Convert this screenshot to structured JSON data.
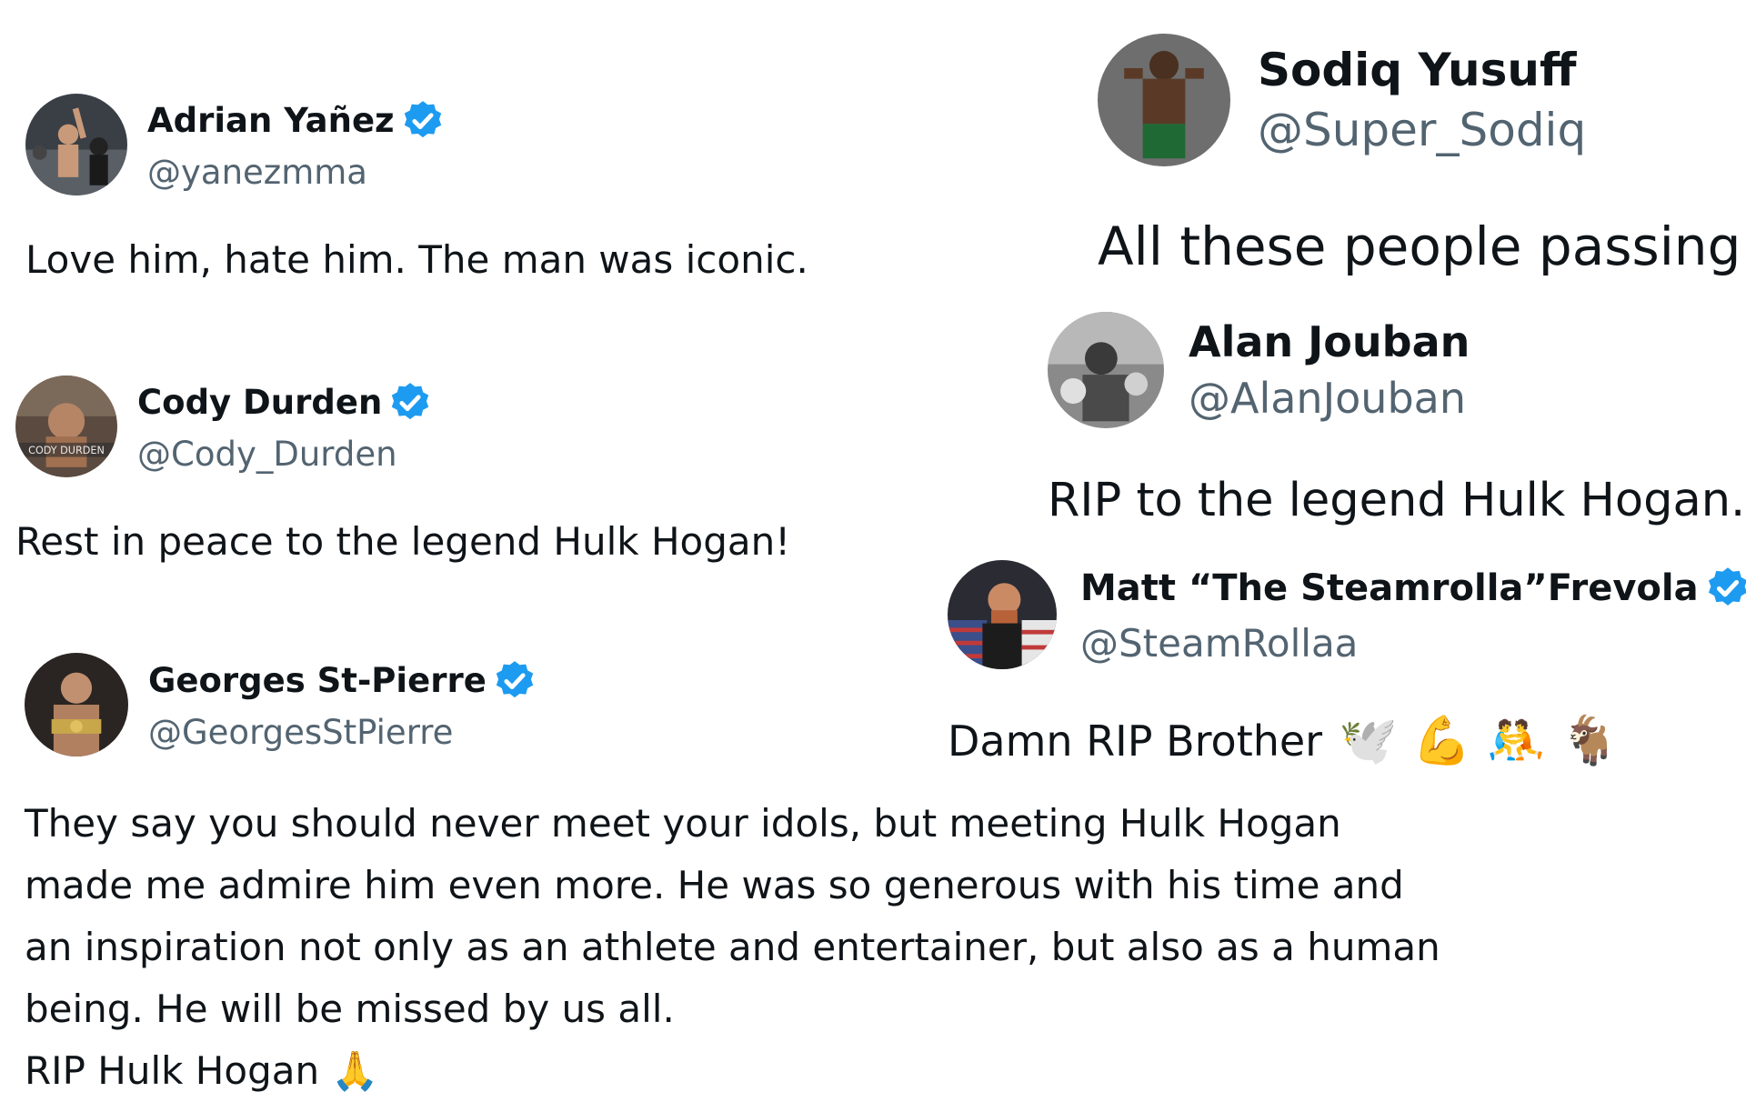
{
  "posts": [
    {
      "name": "Adrian Yañez",
      "handle": "@yanezmma",
      "verified": true,
      "text": "Love him, hate him. The man was iconic."
    },
    {
      "name": "Cody Durden",
      "handle": "@Cody_Durden",
      "verified": true,
      "avatar_caption": "CODY DURDEN",
      "text": "Rest in peace to the legend Hulk Hogan!"
    },
    {
      "name": "Georges St-Pierre",
      "handle": "@GeorgesStPierre",
      "verified": true,
      "lines": [
        "They say you should never meet your idols, but meeting Hulk Hogan",
        "made me admire him even more. He was so generous with his time and",
        "an inspiration not only as an athlete and entertainer, but also as a human",
        "being. He will be missed by us all.",
        "RIP Hulk Hogan 🙏"
      ]
    },
    {
      "name": "Sodiq Yusuff",
      "handle": "@Super_Sodiq",
      "verified": false,
      "text": "All these people passing"
    },
    {
      "name": "Alan Jouban",
      "handle": "@AlanJouban",
      "verified": false,
      "text": "RIP to the legend Hulk Hogan."
    },
    {
      "name": "Matt “The Steamrolla”Frevola",
      "handle": "@SteamRollaa",
      "verified": true,
      "text": "Damn RIP Brother",
      "emojis": "🕊️ 💪 🤼 🐐"
    }
  ],
  "colors": {
    "text": "#0f1419",
    "handle": "#536471",
    "verified_badge": "#1d9bf0"
  },
  "icons": {
    "verified": "verified-badge-icon"
  }
}
